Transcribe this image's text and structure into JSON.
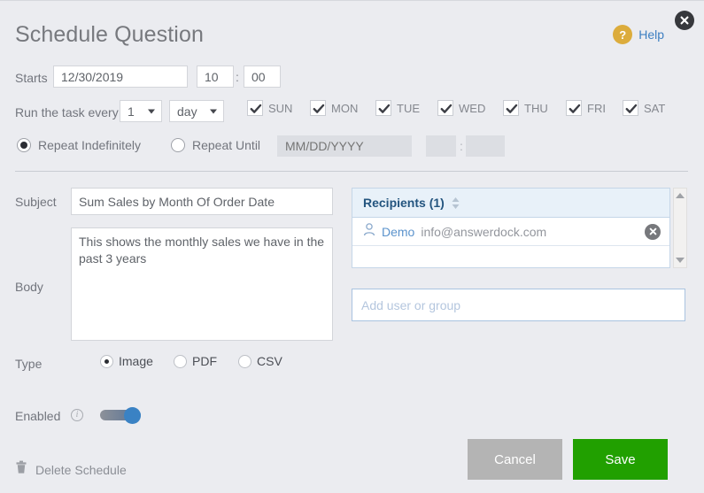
{
  "header": {
    "title": "Schedule Question",
    "help_label": "Help",
    "help_glyph": "?",
    "close_icon": "close-icon"
  },
  "schedule": {
    "starts_label": "Starts",
    "start_date": "12/30/2019",
    "start_hour": "10",
    "start_minute": "00",
    "time_separator": ":",
    "every_label": "Run the task every",
    "interval_value": "1",
    "unit_value": "day",
    "days": [
      {
        "label": "SUN",
        "checked": true
      },
      {
        "label": "MON",
        "checked": true
      },
      {
        "label": "TUE",
        "checked": true
      },
      {
        "label": "WED",
        "checked": true
      },
      {
        "label": "THU",
        "checked": true
      },
      {
        "label": "FRI",
        "checked": true
      },
      {
        "label": "SAT",
        "checked": true
      }
    ],
    "repeat_indefinitely_label": "Repeat Indefinitely",
    "repeat_indefinitely_selected": true,
    "repeat_until_label": "Repeat Until",
    "repeat_until_selected": false,
    "until_date_placeholder": "MM/DD/YYYY",
    "until_hour": "",
    "until_minute": "",
    "until_separator": ":"
  },
  "message": {
    "subject_label": "Subject",
    "subject_value": "Sum Sales by Month Of Order Date",
    "body_label": "Body",
    "body_value": "This shows the monthly sales we have in the past 3 years"
  },
  "recipients": {
    "header_title": "Recipients (1)",
    "sort_icon": "sort-arrows-icon",
    "list": [
      {
        "user_icon": "person-icon",
        "name": "Demo",
        "email": "info@answerdock.com",
        "remove_icon": "remove-icon"
      }
    ],
    "add_placeholder": "Add user or group",
    "add_value": "",
    "scroll_up_icon": "scroll-up-icon",
    "scroll_down_icon": "scroll-down-icon"
  },
  "type": {
    "label": "Type",
    "options": [
      {
        "label": "Image",
        "selected": true
      },
      {
        "label": "PDF",
        "selected": false
      },
      {
        "label": "CSV",
        "selected": false
      }
    ]
  },
  "enabled": {
    "label": "Enabled",
    "info_icon": "info-icon",
    "toggle_on": true
  },
  "footer": {
    "delete_label": "Delete Schedule",
    "delete_icon": "trash-icon",
    "cancel_label": "Cancel",
    "save_label": "Save"
  },
  "colors": {
    "background": "#ebecf0",
    "accent_blue": "#3d7fc1",
    "save_green": "#21a000",
    "cancel_grey": "#b4b4b4",
    "help_gold": "#dcac3c",
    "recipients_header": "#e8f1f9"
  }
}
